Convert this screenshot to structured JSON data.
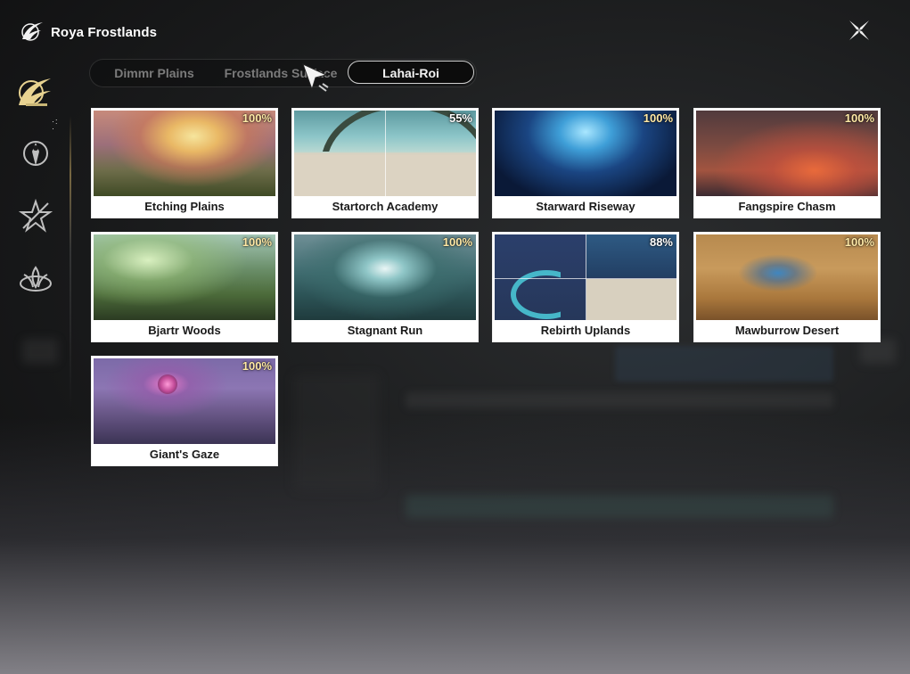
{
  "header": {
    "title": "Roya Frostlands"
  },
  "tabs": [
    {
      "label": "Dimmr Plains",
      "active": false
    },
    {
      "label": "Frostlands Surface",
      "active": false
    },
    {
      "label": "Lahai-Roi",
      "active": true
    }
  ],
  "sidebar": {
    "items": [
      {
        "icon": "roya-emblem-icon",
        "active": true
      },
      {
        "icon": "figure-crest-icon",
        "active": false
      },
      {
        "icon": "star-emblem-icon",
        "active": false
      },
      {
        "icon": "lotus-crest-icon",
        "active": false
      }
    ]
  },
  "regions": [
    {
      "name": "Etching Plains",
      "progress": "100%"
    },
    {
      "name": "Startorch Academy",
      "progress": "55%"
    },
    {
      "name": "Starward Riseway",
      "progress": "100%"
    },
    {
      "name": "Fangspire Chasm",
      "progress": "100%"
    },
    {
      "name": "Bjartr Woods",
      "progress": "100%"
    },
    {
      "name": "Stagnant Run",
      "progress": "100%"
    },
    {
      "name": "Rebirth Uplands",
      "progress": "88%"
    },
    {
      "name": "Mawburrow Desert",
      "progress": "100%"
    },
    {
      "name": "Giant's Gaze",
      "progress": "100%"
    }
  ],
  "colors": {
    "accent_gold": "#ffe9a6",
    "tab_active_border": "#d0d0d0",
    "card_bg": "#ffffff"
  }
}
